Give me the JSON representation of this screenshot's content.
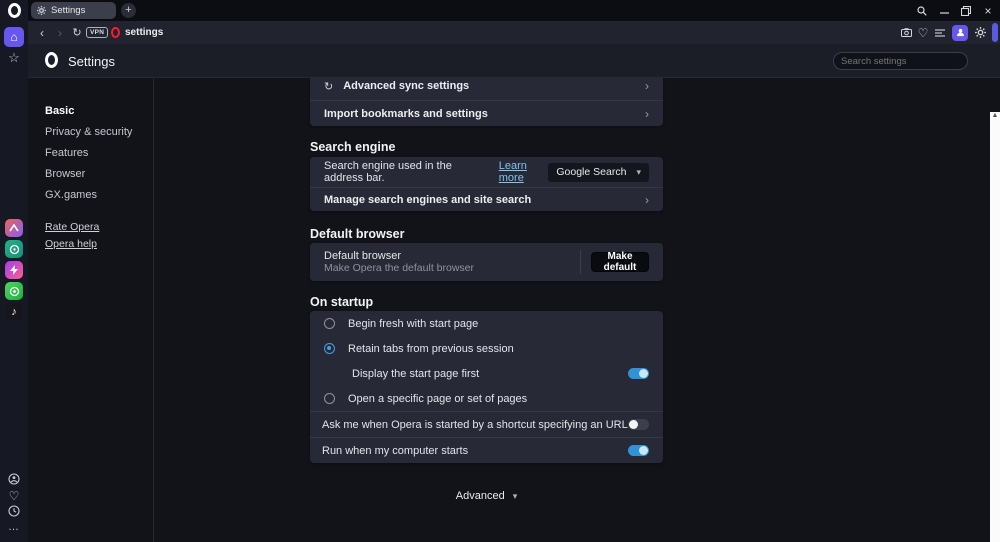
{
  "browser": {
    "tab_title": "Settings",
    "new_tab_button": "+",
    "url_text": "settings",
    "vpn_badge": "VPN"
  },
  "page_header": {
    "title": "Settings",
    "search_placeholder": "Search settings"
  },
  "nav": {
    "items": [
      {
        "label": "Basic",
        "selected": true
      },
      {
        "label": "Privacy & security",
        "selected": false
      },
      {
        "label": "Features",
        "selected": false
      },
      {
        "label": "Browser",
        "selected": false
      },
      {
        "label": "GX.games",
        "selected": false
      }
    ],
    "links": [
      {
        "label": "Rate Opera"
      },
      {
        "label": "Opera help"
      }
    ]
  },
  "sync_card": {
    "advanced_sync_label": "Advanced sync settings",
    "import_label": "Import bookmarks and settings"
  },
  "search_engine": {
    "heading": "Search engine",
    "row_text": "Search engine used in the address bar.",
    "learn_more_label": "Learn more",
    "dropdown_value": "Google Search",
    "manage_label": "Manage search engines and site search"
  },
  "default_browser": {
    "heading": "Default browser",
    "title": "Default browser",
    "subtitle": "Make Opera the default browser",
    "button_label": "Make default"
  },
  "on_startup": {
    "heading": "On startup",
    "options": [
      {
        "label": "Begin fresh with start page",
        "control": "radio",
        "checked": false
      },
      {
        "label": "Retain tabs from previous session",
        "control": "radio",
        "checked": true
      },
      {
        "label": "Display the start page first",
        "control": "toggle",
        "checked": true
      },
      {
        "label": "Open a specific page or set of pages",
        "control": "radio",
        "checked": false
      },
      {
        "label": "Ask me when Opera is started by a shortcut specifying an URL",
        "control": "toggle",
        "checked": false
      },
      {
        "label": "Run when my computer starts",
        "control": "toggle",
        "checked": true
      }
    ]
  },
  "footer": {
    "advanced_label": "Advanced"
  },
  "sidebar_apps": [
    "aria",
    "spotify",
    "messenger",
    "whatsapp",
    "tiktok"
  ],
  "colors": {
    "accent_blue": "#3fa3e0",
    "accent_purple": "#6657f1",
    "link_blue": "#7cc5ec",
    "opera_red": "#ff1b2d",
    "card_bg": "#272936",
    "page_bg": "#121319"
  }
}
